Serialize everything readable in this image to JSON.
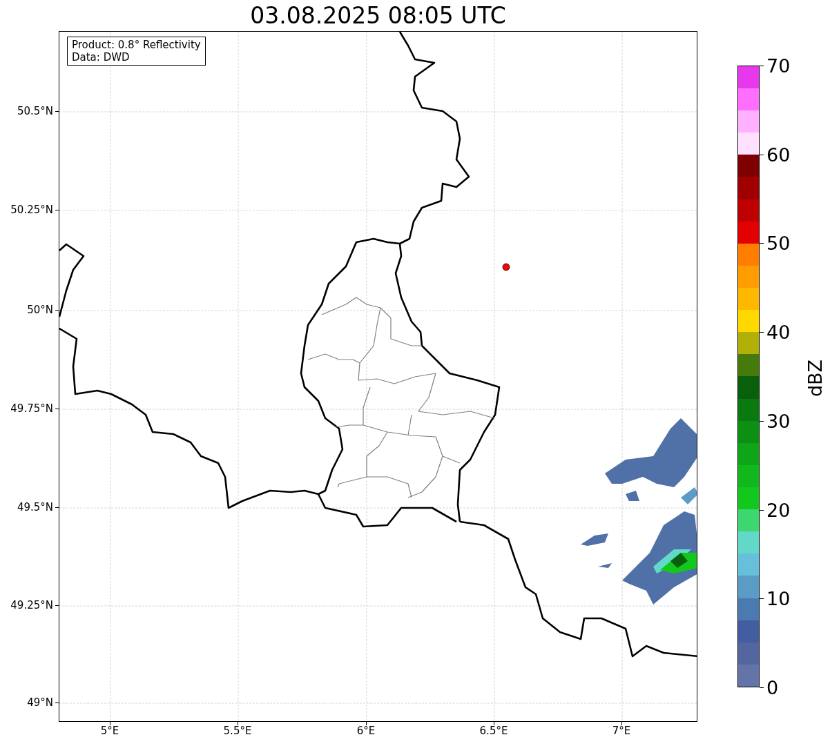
{
  "title": "03.08.2025 08:05 UTC",
  "legend": [
    "Product: 0.8° Reflectivity",
    "Data: DWD"
  ],
  "map": {
    "xticks": [
      "5°E",
      "5.5°E",
      "6°E",
      "6.5°E",
      "7°E"
    ],
    "yticks": [
      "50.5°N",
      "50.25°N",
      "50°N",
      "49.75°N",
      "49.5°N",
      "49.25°N",
      "49°N"
    ]
  },
  "colorbar": {
    "label": "dBZ",
    "ticks": [
      "70",
      "60",
      "50",
      "40",
      "30",
      "20",
      "10",
      "0"
    ],
    "segments": [
      {
        "color": "#6474a8"
      },
      {
        "color": "#5366a0"
      },
      {
        "color": "#425ea0"
      },
      {
        "color": "#4b7ab0"
      },
      {
        "color": "#5a9cc6"
      },
      {
        "color": "#66c0dc"
      },
      {
        "color": "#62d8c8"
      },
      {
        "color": "#3ed66e"
      },
      {
        "color": "#12c81c"
      },
      {
        "color": "#10b81c"
      },
      {
        "color": "#0ea618"
      },
      {
        "color": "#0c9014"
      },
      {
        "color": "#0a7a10"
      },
      {
        "color": "#08600c"
      },
      {
        "color": "#467a0a"
      },
      {
        "color": "#b0b008"
      },
      {
        "color": "#ffd800"
      },
      {
        "color": "#ffb800"
      },
      {
        "color": "#ff9c00"
      },
      {
        "color": "#ff7e00"
      },
      {
        "color": "#e20000"
      },
      {
        "color": "#be0000"
      },
      {
        "color": "#a00000"
      },
      {
        "color": "#7e0000"
      },
      {
        "color": "#ffe0ff"
      },
      {
        "color": "#ffb0ff"
      },
      {
        "color": "#ff6eff"
      },
      {
        "color": "#e838ee"
      }
    ]
  }
}
